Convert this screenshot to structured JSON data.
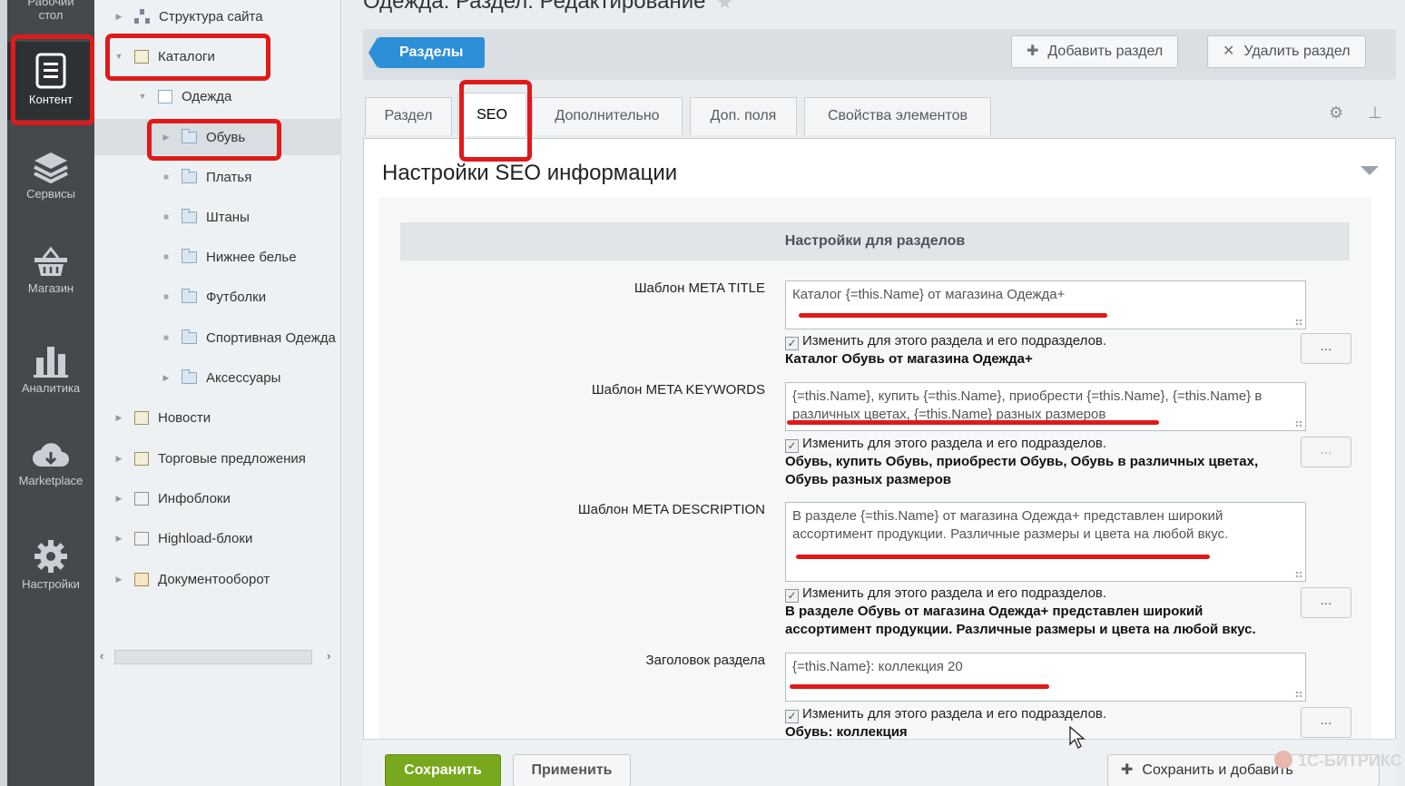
{
  "sidebar": {
    "items": [
      {
        "label": "Рабочий стол",
        "icon": "desktop-icon"
      },
      {
        "label": "Контент",
        "icon": "document-icon",
        "active": true
      },
      {
        "label": "Сервисы",
        "icon": "layers-icon"
      },
      {
        "label": "Магазин",
        "icon": "basket-icon"
      },
      {
        "label": "Аналитика",
        "icon": "bar-chart-icon"
      },
      {
        "label": "Marketplace",
        "icon": "cloud-download-icon"
      },
      {
        "label": "Настройки",
        "icon": "gear-icon"
      }
    ]
  },
  "tree": {
    "items": [
      {
        "label": "Структура сайта",
        "icon": "sitemap-icon"
      },
      {
        "label": "Каталоги",
        "icon": "iblock-icon"
      },
      {
        "label": "Одежда",
        "icon": "iblock-list-icon"
      },
      {
        "label": "Обувь",
        "icon": "folder-icon"
      },
      {
        "label": "Платья",
        "icon": "folder-icon"
      },
      {
        "label": "Штаны",
        "icon": "folder-icon"
      },
      {
        "label": "Нижнее белье",
        "icon": "folder-icon"
      },
      {
        "label": "Футболки",
        "icon": "folder-icon"
      },
      {
        "label": "Спортивная Одежда",
        "icon": "folder-icon"
      },
      {
        "label": "Аксессуары",
        "icon": "folder-icon"
      },
      {
        "label": "Новости",
        "icon": "iblock-icon"
      },
      {
        "label": "Торговые предложения",
        "icon": "iblock-icon"
      },
      {
        "label": "Инфоблоки",
        "icon": "iblock-gear-icon"
      },
      {
        "label": "Highload-блоки",
        "icon": "iblock-gear-icon"
      },
      {
        "label": "Документооборот",
        "icon": "workflow-icon"
      }
    ]
  },
  "header": {
    "title": "Одежда: Раздел: Редактирование"
  },
  "toolbar": {
    "sections_label": "Разделы",
    "add_label": "Добавить раздел",
    "delete_label": "Удалить раздел"
  },
  "tabs": [
    {
      "label": "Раздел"
    },
    {
      "label": "SEO",
      "active": true
    },
    {
      "label": "Дополнительно"
    },
    {
      "label": "Доп. поля"
    },
    {
      "label": "Свойства элементов"
    }
  ],
  "seo": {
    "heading": "Настройки SEO информации",
    "section_title": "Настройки для разделов",
    "fields": [
      {
        "label": "Шаблон META TITLE",
        "value": "Каталог {=this.Name} от магазина Одежда+",
        "checkbox": "Изменить для этого раздела и его подразделов.",
        "preview": "Каталог Обувь от магазина Одежда+"
      },
      {
        "label": "Шаблон META KEYWORDS",
        "value": "{=this.Name}, купить {=this.Name}, приобрести {=this.Name}, {=this.Name} в различных цветах, {=this.Name} разных размеров",
        "checkbox": "Изменить для этого раздела и его подразделов.",
        "preview_line1": "Обувь, купить Обувь, приобрести Обувь, Обувь в различных цветах,",
        "preview_line2": "Обувь разных размеров"
      },
      {
        "label": "Шаблон META DESCRIPTION",
        "value": "В разделе {=this.Name} от магазина Одежда+ представлен широкий ассортимент продукции. Различные размеры и цвета на любой вкус.",
        "checkbox": "Изменить для этого раздела и его подразделов.",
        "preview_line1": "В разделе Обувь от магазина Одежда+ представлен широкий",
        "preview_line2": "ассортимент продукции. Различные размеры и цвета на любой вкус."
      },
      {
        "label": "Заголовок раздела",
        "value": "{=this.Name}: коллекция 20",
        "checkbox": "Изменить для этого раздела и его подразделов.",
        "preview": "Обувь: коллекция"
      }
    ],
    "dots_label": "..."
  },
  "footer": {
    "save_label": "Сохранить",
    "apply_label": "Применить",
    "save_add_label": "Сохранить и добавить",
    "logo_text": "1С-БИТРИКС"
  },
  "colors": {
    "accent": "#2c8fd8",
    "save": "#78a81e",
    "highlight": "#e01919"
  }
}
